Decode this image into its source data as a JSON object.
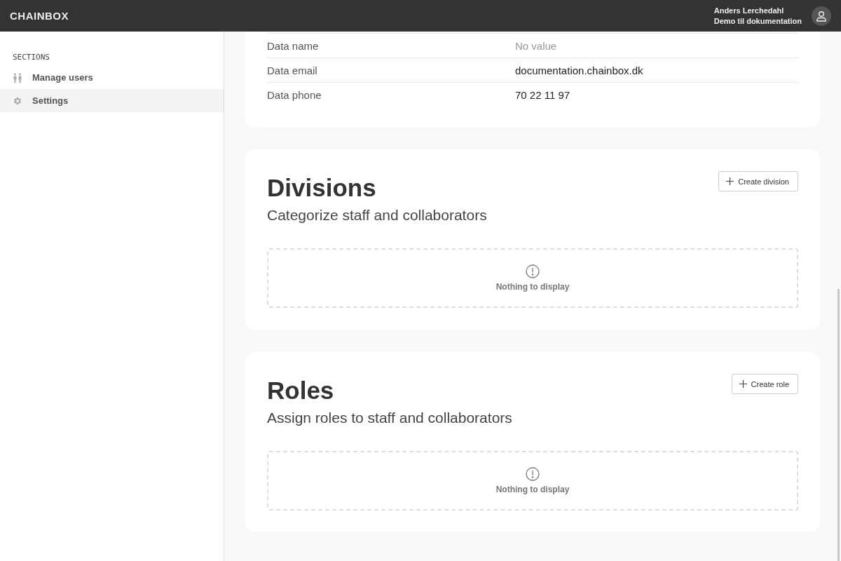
{
  "header": {
    "logo": "CHAINBOX",
    "user_name": "Anders Lerchedahl",
    "organization": "Demo til dokumentation"
  },
  "sidebar": {
    "heading": "SECTIONS",
    "items": [
      {
        "label": "Manage users",
        "kind": "users",
        "selected": false
      },
      {
        "label": "Settings",
        "kind": "settings",
        "selected": true
      }
    ]
  },
  "details": {
    "rows": [
      {
        "label": "Data name",
        "value": "No value",
        "muted": true
      },
      {
        "label": "Data email",
        "value": "documentation.chainbox.dk",
        "muted": false
      },
      {
        "label": "Data phone",
        "value": "70 22 11 97",
        "muted": false
      }
    ]
  },
  "sections": [
    {
      "title": "Divisions",
      "subtitle": "Categorize staff and collaborators",
      "button": "Create division",
      "empty_text": "Nothing to display"
    },
    {
      "title": "Roles",
      "subtitle": "Assign roles to staff and collaborators",
      "button": "Create role",
      "empty_text": "Nothing to display"
    }
  ]
}
